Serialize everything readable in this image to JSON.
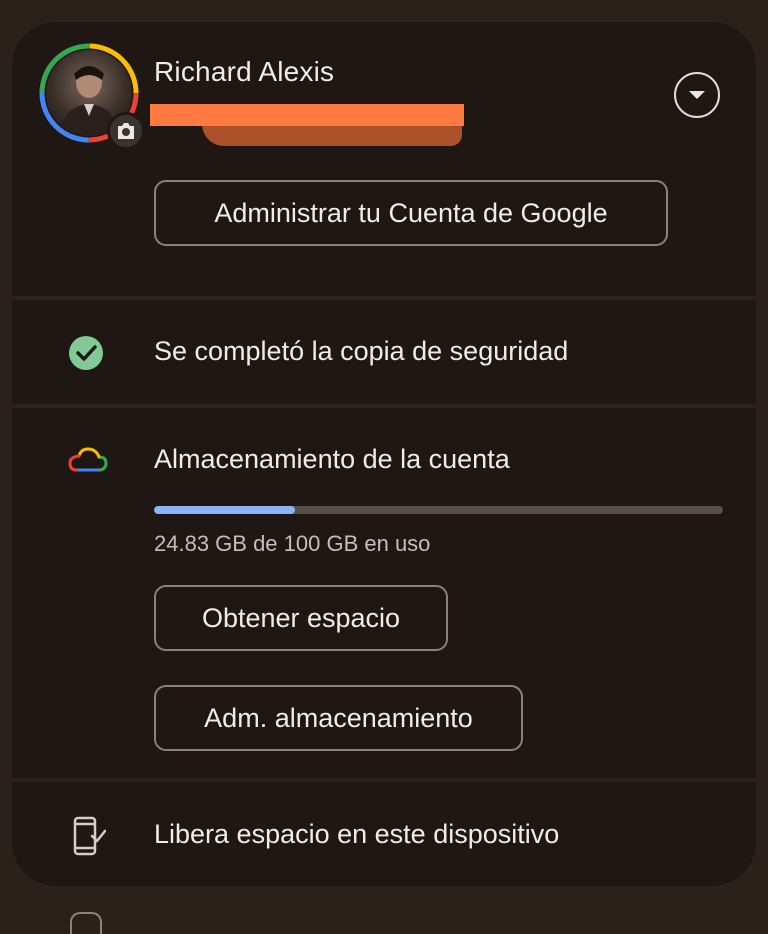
{
  "account": {
    "name": "Richard Alexis",
    "manage_button": "Administrar tu Cuenta de Google"
  },
  "backup": {
    "status": "Se completó la copia de seguridad"
  },
  "storage": {
    "title": "Almacenamiento de la cuenta",
    "usage_text": "24.83 GB de 100 GB en uso",
    "used_fraction": 0.2483,
    "get_space_button": "Obtener espacio",
    "manage_storage_button": "Adm. almacenamiento"
  },
  "device": {
    "free_space": "Libera espacio en este dispositivo"
  },
  "colors": {
    "background": "#2b211b",
    "card": "#1e1714",
    "accent_blue": "#8ab4f8",
    "check_green": "#81c995",
    "redaction": "#ff7a40"
  },
  "icons": [
    "camera-icon",
    "chevron-down-icon",
    "check-circle-icon",
    "cloud-icon",
    "phone-clean-icon"
  ]
}
